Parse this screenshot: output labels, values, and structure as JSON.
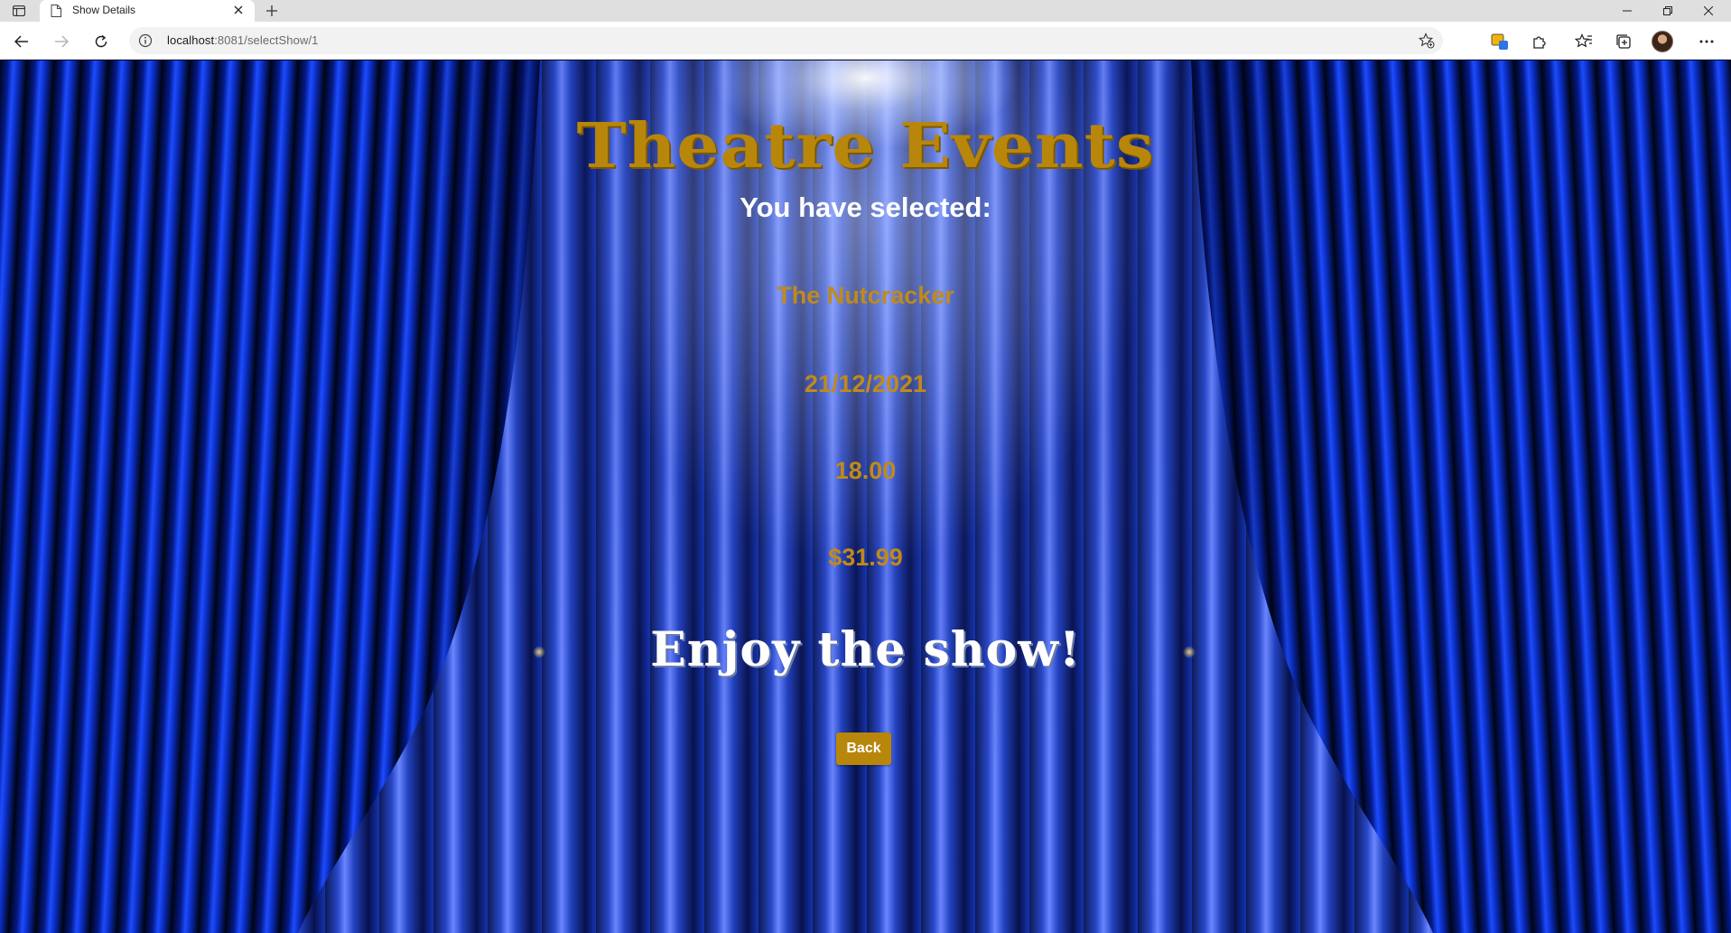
{
  "browser": {
    "tab_title": "Show Details",
    "url_host": "localhost",
    "url_rest": ":8081/selectShow/1"
  },
  "page": {
    "title": "Theatre Events",
    "subtitle": "You have selected:",
    "show": {
      "name": "The Nutcracker",
      "date": "21/12/2021",
      "time": "18.00",
      "price": "$31.99"
    },
    "closing": "Enjoy the show!",
    "back_label": "Back"
  },
  "colors": {
    "gold": "#b8860b",
    "curtain_blue": "#1c4cff",
    "white": "#ffffff"
  }
}
